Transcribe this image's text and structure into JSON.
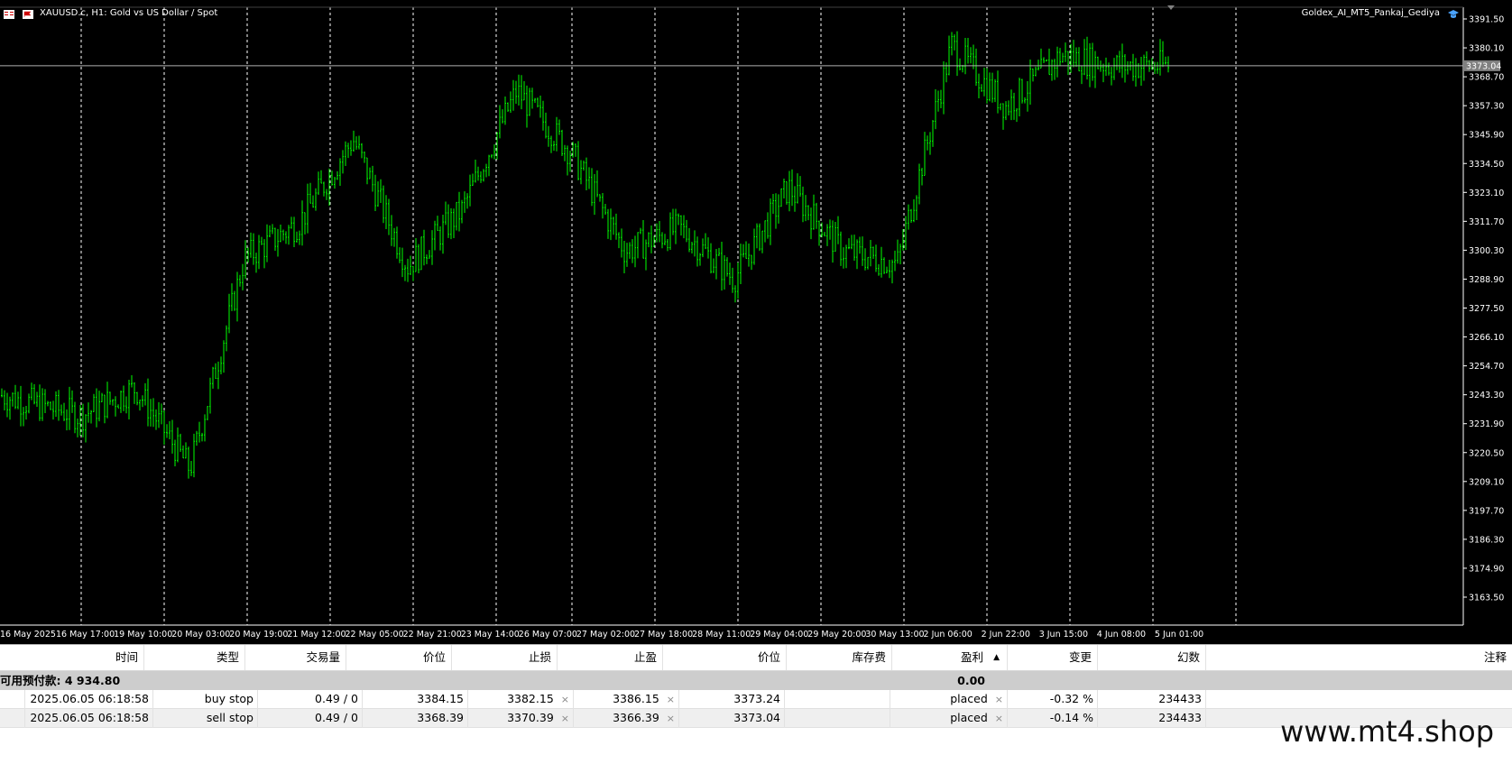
{
  "chart": {
    "title": "XAUUSD.c, H1:  Gold vs US Dollar / Spot",
    "ea_name": "Goldex_AI_MT5_Pankaj_Gediya",
    "current_price_label": "3373.04",
    "price_axis_labels": [
      "3391.50",
      "3380.10",
      "3368.70",
      "3357.30",
      "3345.90",
      "3334.50",
      "3323.10",
      "3311.70",
      "3300.30",
      "3288.90",
      "3277.50",
      "3266.10",
      "3254.70",
      "3243.30",
      "3231.90",
      "3220.50",
      "3209.10",
      "3197.70",
      "3186.30",
      "3174.90",
      "3163.50"
    ],
    "time_axis_labels": [
      "16 May 2025",
      "16 May 17:00",
      "19 May 10:00",
      "20 May 03:00",
      "20 May 19:00",
      "21 May 12:00",
      "22 May 05:00",
      "22 May 21:00",
      "23 May 14:00",
      "26 May 07:00",
      "27 May 02:00",
      "27 May 18:00",
      "28 May 11:00",
      "29 May 04:00",
      "29 May 20:00",
      "30 May 13:00",
      "2 Jun 06:00",
      "2 Jun 22:00",
      "3 Jun 15:00",
      "4 Jun 08:00",
      "5 Jun 01:00"
    ],
    "colors": {
      "background": "#000000",
      "candles": "#00ff00",
      "grid": "#ffffff",
      "price_line": "#b0b0b0",
      "text": "#ffffff"
    }
  },
  "chart_data": {
    "type": "line",
    "title": "XAUUSD.c, H1:  Gold vs US Dollar / Spot",
    "ylim": [
      3160,
      3396
    ],
    "grid": true,
    "x": [
      "16 May 2025",
      "16 May 17:00",
      "19 May 10:00",
      "20 May 03:00",
      "20 May 19:00",
      "21 May 12:00",
      "22 May 05:00",
      "22 May 21:00",
      "23 May 14:00",
      "26 May 07:00",
      "27 May 02:00",
      "27 May 18:00",
      "28 May 11:00",
      "29 May 04:00",
      "29 May 20:00",
      "30 May 13:00",
      "2 Jun 06:00",
      "2 Jun 22:00",
      "3 Jun 15:00",
      "4 Jun 08:00",
      "5 Jun 01:00"
    ],
    "series": [
      {
        "values": [
          3243,
          3235,
          3246,
          3214,
          3297,
          3311,
          3344,
          3294,
          3316,
          3363,
          3339,
          3300,
          3309,
          3289,
          3325,
          3300,
          3295,
          3381,
          3357,
          3377,
          3373
        ]
      }
    ]
  },
  "terminal": {
    "headers": [
      "时间",
      "类型",
      "交易量",
      "价位",
      "止损",
      "止盈",
      "价位",
      "库存费",
      "盈利",
      "变更",
      "幻数",
      "注释"
    ],
    "sort_indicator": "▲",
    "balance_label": "可用预付款: 4 934.80",
    "balance_profit": "0.00",
    "rows": [
      {
        "time": "2025.06.05 06:18:58",
        "type": "buy stop",
        "volume": "0.49 / 0",
        "price": "3384.15",
        "sl": "3382.15",
        "tp": "3386.15",
        "current": "3373.24",
        "swap": "",
        "profit": "placed",
        "change": "-0.32 %",
        "magic": "234433",
        "comment": ""
      },
      {
        "time": "2025.06.05 06:18:58",
        "type": "sell stop",
        "volume": "0.49 / 0",
        "price": "3368.39",
        "sl": "3370.39",
        "tp": "3366.39",
        "current": "3373.04",
        "swap": "",
        "profit": "placed",
        "change": "-0.14 %",
        "magic": "234433",
        "comment": ""
      }
    ],
    "close_glyph": "×"
  },
  "watermark": "www.mt4.shop"
}
